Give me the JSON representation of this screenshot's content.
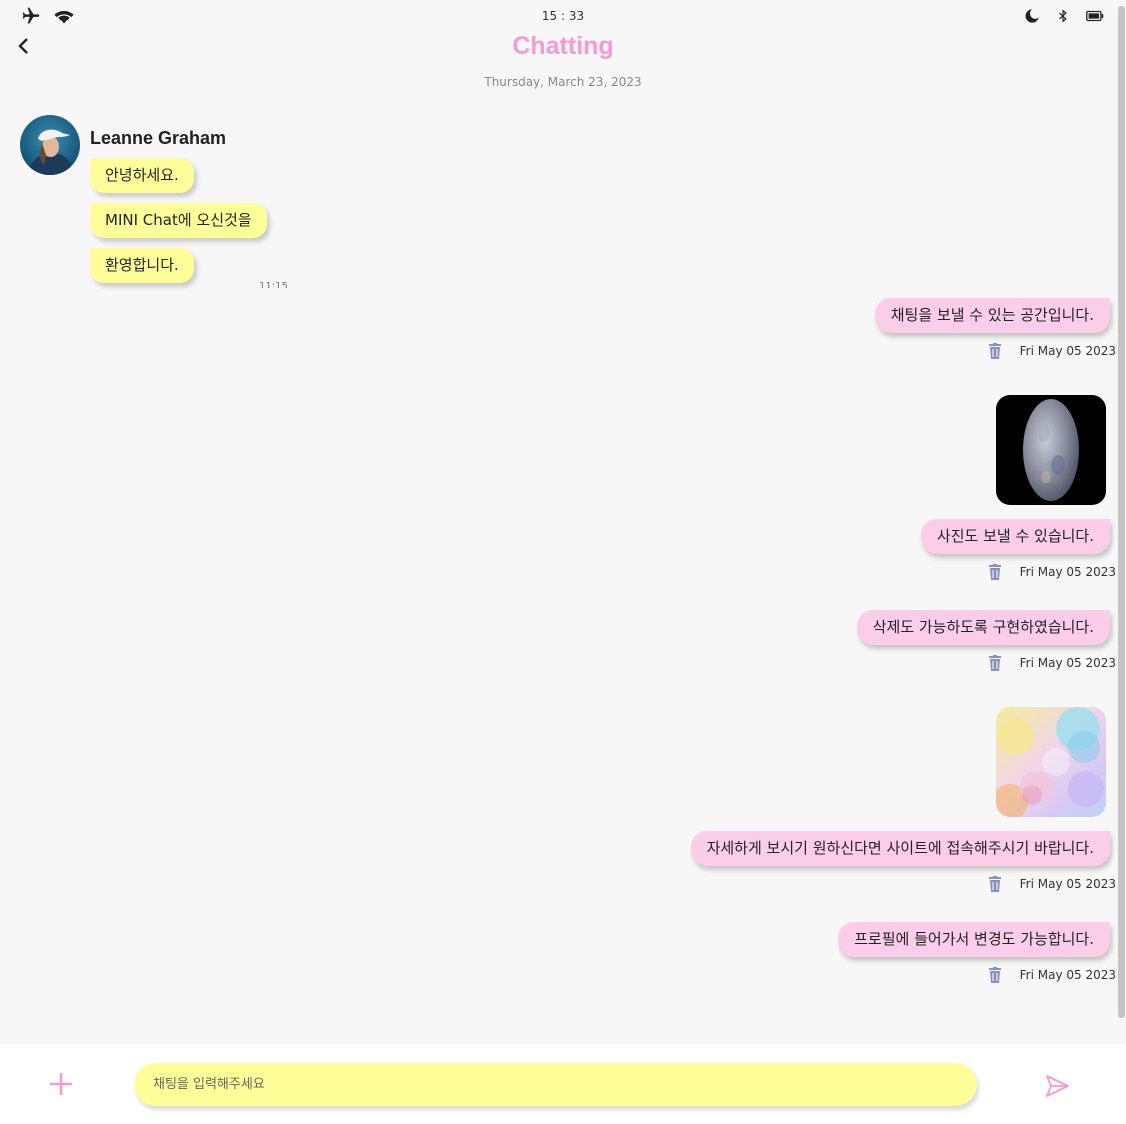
{
  "status_bar": {
    "time": "15 : 33"
  },
  "header": {
    "title": "Chatting",
    "date": "Thursday, March 23, 2023"
  },
  "incoming": {
    "sender_name": "Leanne Graham",
    "messages": [
      "안녕하세요.",
      "MINI Chat에 오신것을",
      "환영합니다."
    ],
    "time": "11:15"
  },
  "outgoing": [
    {
      "text": "채팅을 보낼 수 있는 공간입니다.",
      "date": "Fri May 05 2023"
    },
    {
      "text": "사진도 보낼 수 있습니다.",
      "date": "Fri May 05 2023"
    },
    {
      "text": "삭제도 가능하도록 구현하였습니다.",
      "date": "Fri May 05 2023"
    },
    {
      "text": "자세하게 보시기 원하신다면 사이트에 접속해주시기 바랍니다.",
      "date": "Fri May 05 2023"
    },
    {
      "text": "프로필에 들어가서 변경도 가능합니다.",
      "date": "Fri May 05 2023"
    }
  ],
  "photos": [
    {
      "icon": "planet-photo"
    },
    {
      "icon": "bokeh-photo"
    }
  ],
  "composer": {
    "placeholder": "채팅을 입력해주세요",
    "value": ""
  },
  "colors": {
    "accent_pink": "#f79ad3",
    "incoming_bubble": "#ffff99",
    "outgoing_bubble": "#fccde8",
    "trash_icon": "#8a8fbf"
  }
}
